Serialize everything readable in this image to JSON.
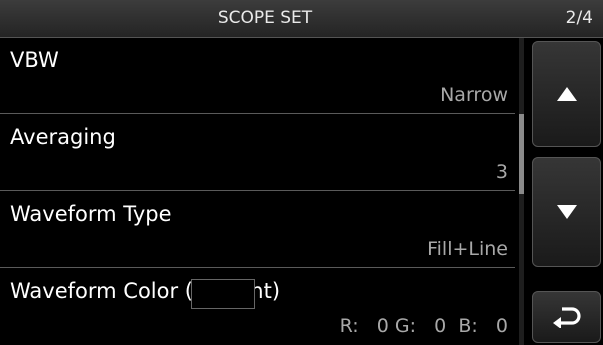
{
  "header": {
    "title": "SCOPE SET",
    "page": "2/4"
  },
  "items": [
    {
      "label": "VBW",
      "value": "Narrow"
    },
    {
      "label": "Averaging",
      "value": "3"
    },
    {
      "label": "Waveform Type",
      "value": "Fill+Line"
    },
    {
      "label": "Waveform Color (Current)",
      "value": ""
    }
  ],
  "color": {
    "r_label": "R:",
    "r": "0",
    "g_label": "G:",
    "g": "0",
    "b_label": "B:",
    "b": "0",
    "swatch": "#000000"
  },
  "buttons": {
    "up_icon": "up-arrow-icon",
    "down_icon": "down-arrow-icon",
    "back_icon": "return-arrow-icon"
  }
}
